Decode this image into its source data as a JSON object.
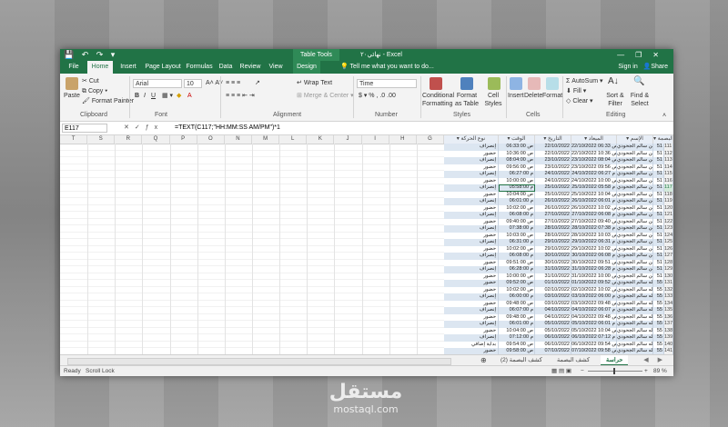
{
  "app": {
    "doc_title": "نهائي٢٠ - Excel",
    "table_tools": "Table Tools",
    "window_controls": [
      "—",
      "❐",
      "✕"
    ]
  },
  "tabs": [
    "File",
    "Home",
    "Insert",
    "Page Layout",
    "Formulas",
    "Data",
    "Review",
    "View",
    "Design"
  ],
  "active_tab": "Home",
  "tell_me": "Tell me what you want to do...",
  "sign_in": "Sign in",
  "share": "Share",
  "ribbon": {
    "clipboard": {
      "label": "Clipboard",
      "paste": "Paste",
      "cut": "Cut",
      "copy": "Copy",
      "format_painter": "Format Painter"
    },
    "font": {
      "label": "Font",
      "family": "Arial",
      "size": "10"
    },
    "alignment": {
      "label": "Alignment",
      "wrap": "Wrap Text",
      "merge": "Merge & Center"
    },
    "number": {
      "label": "Number",
      "format": "Time"
    },
    "styles": {
      "label": "Styles",
      "conditional": "Conditional Formatting",
      "format_table": "Format as Table",
      "cell_styles": "Cell Styles"
    },
    "cells": {
      "label": "Cells",
      "insert": "Insert",
      "delete": "Delete",
      "format": "Format"
    },
    "editing": {
      "label": "Editing",
      "autosum": "AutoSum",
      "fill": "Fill",
      "clear": "Clear",
      "sort": "Sort & Filter",
      "find": "Find & Select"
    }
  },
  "formula_bar": {
    "name_box": "E117",
    "formula": "=TEXT(C117;\"HH:MM:SS AM/PM\")*1"
  },
  "columns_empty": [
    "T",
    "S",
    "R",
    "Q",
    "P",
    "O",
    "N",
    "M",
    "L",
    "K",
    "J",
    "I",
    "H",
    "G"
  ],
  "table_headers": {
    "move": "نوع الحركة",
    "time": "الوقت",
    "date": "التاريخ",
    "datetime": "الميعاد",
    "name": "الإسم",
    "id": "رقم البصمة"
  },
  "rows": [
    {
      "rn": "111",
      "id": "51",
      "name": "حسن سالم الجحودي",
      "dt": "22/10/2022 06:33 ص",
      "date": "22/10/2022",
      "time": "06:33:00 ص",
      "move": "إنصراف"
    },
    {
      "rn": "112",
      "id": "51",
      "name": "حسن سالم الجحودي",
      "dt": "22/10/2022 10:36 ص",
      "date": "22/10/2022",
      "time": "10:36:00 ص",
      "move": "حضور"
    },
    {
      "rn": "113",
      "id": "51",
      "name": "حسن سالم الجحودي",
      "dt": "23/10/2022 08:04 ص",
      "date": "23/10/2022",
      "time": "08:04:00 ص",
      "move": "إنصراف"
    },
    {
      "rn": "114",
      "id": "51",
      "name": "حسن سالم الجحودي",
      "dt": "23/10/2022 09:56 ص",
      "date": "23/10/2022",
      "time": "09:56:00 ص",
      "move": "حضور"
    },
    {
      "rn": "115",
      "id": "51",
      "name": "حسن سالم الجحودي",
      "dt": "24/10/2022 06:27 م",
      "date": "24/10/2022",
      "time": "06:27:00 م",
      "move": "إنصراف"
    },
    {
      "rn": "116",
      "id": "51",
      "name": "حسن سالم الجحودي",
      "dt": "24/10/2022 10:00 ص",
      "date": "24/10/2022",
      "time": "10:00:00 ص",
      "move": "حضور"
    },
    {
      "rn": "117",
      "id": "51",
      "name": "حسن سالم الجحودي",
      "dt": "25/10/2022 05:58 م",
      "date": "25/10/2022",
      "time": "05:58:00 م",
      "move": "إنصراف"
    },
    {
      "rn": "118",
      "id": "51",
      "name": "حسن سالم الجحودي",
      "dt": "25/10/2022 10:04 ص",
      "date": "25/10/2022",
      "time": "10:04:00 ص",
      "move": "حضور"
    },
    {
      "rn": "119",
      "id": "51",
      "name": "حسن سالم الجحودي",
      "dt": "26/10/2022 06:01 م",
      "date": "26/10/2022",
      "time": "06:01:00 م",
      "move": "إنصراف"
    },
    {
      "rn": "120",
      "id": "51",
      "name": "حسن سالم الجحودي",
      "dt": "26/10/2022 10:02 ص",
      "date": "26/10/2022",
      "time": "10:02:00 ص",
      "move": "حضور"
    },
    {
      "rn": "121",
      "id": "51",
      "name": "حسن سالم الجحودي",
      "dt": "27/10/2022 06:08 م",
      "date": "27/10/2022",
      "time": "06:08:00 م",
      "move": "إنصراف"
    },
    {
      "rn": "122",
      "id": "51",
      "name": "حسن سالم الجحودي",
      "dt": "27/10/2022 09:40 ص",
      "date": "27/10/2022",
      "time": "09:40:00 ص",
      "move": "حضور"
    },
    {
      "rn": "123",
      "id": "51",
      "name": "حسن سالم الجحودي",
      "dt": "28/10/2022 07:38 م",
      "date": "28/10/2022",
      "time": "07:38:00 م",
      "move": "إنصراف"
    },
    {
      "rn": "124",
      "id": "51",
      "name": "حسن سالم الجحودي",
      "dt": "28/10/2022 10:03 ص",
      "date": "28/10/2022",
      "time": "10:03:00 ص",
      "move": "حضور"
    },
    {
      "rn": "125",
      "id": "51",
      "name": "حسن سالم الجحودي",
      "dt": "29/10/2022 06:31 م",
      "date": "29/10/2022",
      "time": "06:31:00 م",
      "move": "إنصراف"
    },
    {
      "rn": "126",
      "id": "51",
      "name": "حسن سالم الجحودي",
      "dt": "29/10/2022 10:02 ص",
      "date": "29/10/2022",
      "time": "10:02:00 ص",
      "move": "حضور"
    },
    {
      "rn": "127",
      "id": "51",
      "name": "حسن سالم الجحودي",
      "dt": "30/10/2022 06:08 م",
      "date": "30/10/2022",
      "time": "06:08:00 م",
      "move": "إنصراف"
    },
    {
      "rn": "128",
      "id": "51",
      "name": "حسن سالم الجحودي",
      "dt": "30/10/2022 09:51 ص",
      "date": "30/10/2022",
      "time": "09:51:00 ص",
      "move": "حضور"
    },
    {
      "rn": "129",
      "id": "51",
      "name": "حسن سالم الجحودي",
      "dt": "31/10/2022 06:28 م",
      "date": "31/10/2022",
      "time": "06:28:00 م",
      "move": "إنصراف"
    },
    {
      "rn": "130",
      "id": "51",
      "name": "حسن سالم الجحودي",
      "dt": "31/10/2022 10:00 ص",
      "date": "31/10/2022",
      "time": "10:00:00 ص",
      "move": "حضور"
    },
    {
      "rn": "131",
      "id": "55",
      "name": "عبدالله سالم الجحودي",
      "dt": "01/10/2022 09:52 ص",
      "date": "01/10/2022",
      "time": "09:52:00 ص",
      "move": "حضور"
    },
    {
      "rn": "132",
      "id": "55",
      "name": "عبدالله سالم الجحودي",
      "dt": "02/10/2022 10:02 ص",
      "date": "02/10/2022",
      "time": "10:02:00 ص",
      "move": "حضور"
    },
    {
      "rn": "133",
      "id": "55",
      "name": "عبدالله سالم الجحودي",
      "dt": "03/10/2022 06:00 م",
      "date": "03/10/2022",
      "time": "06:00:00 م",
      "move": "إنصراف"
    },
    {
      "rn": "134",
      "id": "55",
      "name": "عبدالله سالم الجحودي",
      "dt": "03/10/2022 09:48 ص",
      "date": "03/10/2022",
      "time": "09:48:00 ص",
      "move": "حضور"
    },
    {
      "rn": "135",
      "id": "55",
      "name": "عبدالله سالم الجحودي",
      "dt": "04/10/2022 06:07 م",
      "date": "04/10/2022",
      "time": "06:07:00 م",
      "move": "إنصراف"
    },
    {
      "rn": "136",
      "id": "55",
      "name": "عبدالله سالم الجحودي",
      "dt": "04/10/2022 09:48 ص",
      "date": "04/10/2022",
      "time": "09:48:00 ص",
      "move": "حضور"
    },
    {
      "rn": "137",
      "id": "55",
      "name": "عبدالله سالم الجحودي",
      "dt": "05/10/2022 06:01 م",
      "date": "05/10/2022",
      "time": "06:01:00 م",
      "move": "إنصراف"
    },
    {
      "rn": "138",
      "id": "55",
      "name": "عبدالله سالم الجحودي",
      "dt": "05/10/2022 10:04 ص",
      "date": "05/10/2022",
      "time": "10:04:00 ص",
      "move": "حضور"
    },
    {
      "rn": "139",
      "id": "55",
      "name": "عبدالله سالم الجحودي",
      "dt": "06/10/2022 07:12 م",
      "date": "06/10/2022",
      "time": "07:12:00 م",
      "move": "إنصراف"
    },
    {
      "rn": "140",
      "id": "55",
      "name": "عبدالله سالم الجحودي",
      "dt": "06/10/2022 09:54 ص",
      "date": "06/10/2022",
      "time": "09:54:00 ص",
      "move": "بداية إضافي"
    },
    {
      "rn": "141",
      "id": "55",
      "name": "عبدالله سالم الجحودي",
      "dt": "07/10/2022 09:58 ص",
      "date": "07/10/2022",
      "time": "09:58:00 ص",
      "move": "حضور"
    }
  ],
  "selected_row": "117",
  "sheets": [
    "حراسة",
    "كشف البصمة",
    "كشف البصمة (2)"
  ],
  "active_sheet": "حراسة",
  "status": {
    "ready": "Ready",
    "scroll_lock": "Scroll Lock",
    "zoom": "89 %"
  },
  "watermark": {
    "ar": "مستقل",
    "en": "mostaql.com"
  },
  "colors": {
    "excel_green": "#217346",
    "table_band": "#dce6f1"
  }
}
